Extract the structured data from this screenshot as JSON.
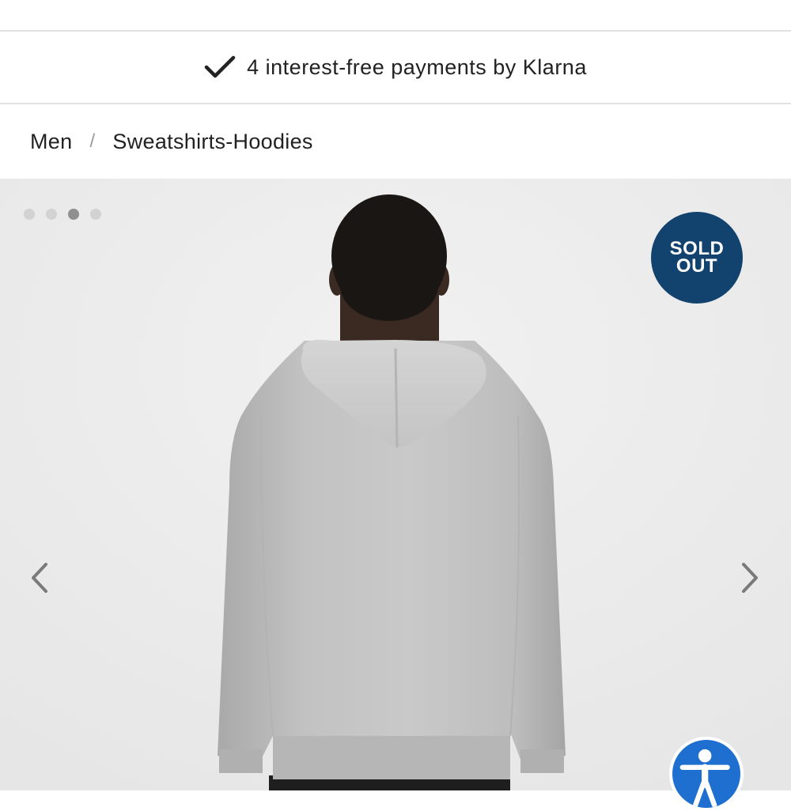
{
  "klarna_bar": {
    "icon": "checkmark-icon",
    "text": "4 interest-free payments by Klarna"
  },
  "breadcrumb": {
    "items": [
      "Men",
      "Sweatshirts-Hoodies"
    ],
    "separator": "/"
  },
  "gallery": {
    "image_count": 4,
    "active_index": 3,
    "badge_line1": "SOLD",
    "badge_line2": "OUT",
    "badge_color": "#12426e",
    "prev_icon": "chevron-left-icon",
    "next_icon": "chevron-right-icon",
    "product_image": "grey hoodie back view"
  },
  "accessibility": {
    "icon": "accessibility-person-icon",
    "color": "#1f6fd0"
  }
}
